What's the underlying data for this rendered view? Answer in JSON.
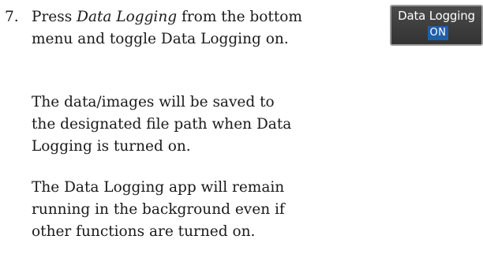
{
  "step": {
    "number": "7.",
    "line1_before": "Press ",
    "line1_italic": "Data Logging",
    "line1_after": " from the bottom",
    "line2": "menu and toggle Data Logging on."
  },
  "paragraph2": {
    "line1": "The data/images will be saved to",
    "line2": "the designated file path when Data",
    "line3": "Logging is turned on."
  },
  "paragraph3": {
    "line1": "The Data Logging app will remain",
    "line2": "running in the background even if",
    "line3": "other functions are turned on."
  },
  "softkey": {
    "label": "Data Logging",
    "state": "ON",
    "colors": {
      "background": "#3c3c3c",
      "border": "#9a9a9a",
      "state_background": "#1f5fa8"
    }
  }
}
